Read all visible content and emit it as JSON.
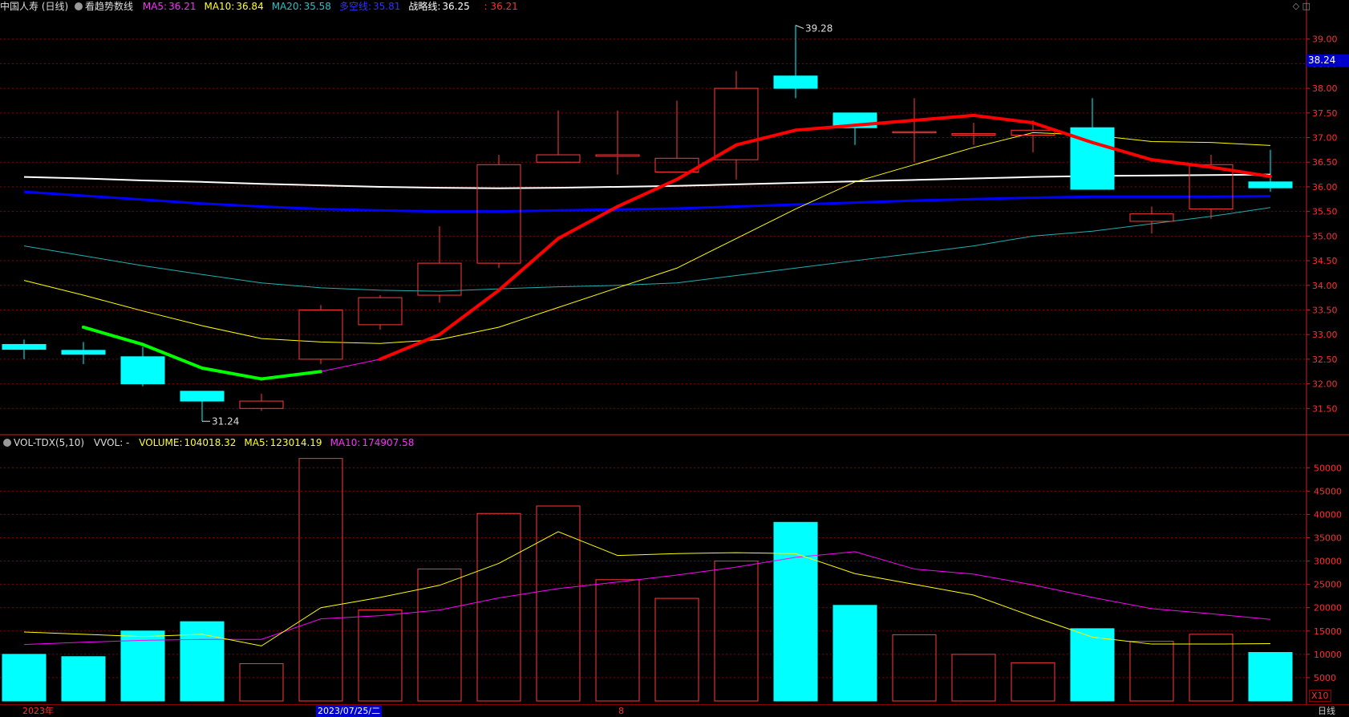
{
  "price_header": {
    "title": "中国人寿 (日线)",
    "indicator": "看趋势数线",
    "items": [
      {
        "label": "MA5:",
        "value": "36.21",
        "color": "#ff30ff"
      },
      {
        "label": "MA10:",
        "value": "36.84",
        "color": "#ffff30"
      },
      {
        "label": "MA20:",
        "value": "35.58",
        "color": "#30c0c0"
      },
      {
        "label": "多空线:",
        "value": "35.81",
        "color": "#3030ff"
      },
      {
        "label": "战略线:",
        "value": "36.25",
        "color": "#ffffff"
      }
    ],
    "extra_value": ": 36.21"
  },
  "vol_header": {
    "indicator": "VOL-TDX(5,10)",
    "vvol": "VVOL: -",
    "items": [
      {
        "label": "VOLUME:",
        "value": "104018.32",
        "color": "#ffff30"
      },
      {
        "label": "MA5:",
        "value": "123014.19",
        "color": "#ffff30"
      },
      {
        "label": "MA10:",
        "value": "174907.58",
        "color": "#ff30ff"
      }
    ]
  },
  "current_price_tag": "38.24",
  "vol_multiplier": "X10",
  "bottom_labels": {
    "year": "2023年",
    "cursor_date": "2023/07/25/二",
    "month": "8",
    "period": "日线"
  },
  "colors": {
    "up": "#ff3a3a",
    "down": "#00ffff",
    "grid": "#8b0000",
    "ma5_up": "#ff0000",
    "ma5_down": "#00ff00",
    "ma10": "#ffff00",
    "ma20": "#20b0b0",
    "duokong": "#0000ff",
    "zhanlue": "#ffffff",
    "vol_ma5": "#ffff00",
    "vol_ma10": "#ff00ff"
  },
  "chart_data": [
    {
      "type": "candlestick",
      "ylim": [
        31.0,
        39.5
      ],
      "yticks": [
        "31.50",
        "32.00",
        "32.50",
        "33.00",
        "33.50",
        "34.00",
        "34.50",
        "35.00",
        "35.50",
        "36.00",
        "36.50",
        "37.00",
        "37.50",
        "38.00",
        "38.50",
        "39.00"
      ],
      "candles": [
        {
          "o": 32.8,
          "h": 32.9,
          "l": 32.5,
          "c": 32.7
        },
        {
          "o": 32.68,
          "h": 32.85,
          "l": 32.4,
          "c": 32.6
        },
        {
          "o": 32.55,
          "h": 32.75,
          "l": 31.95,
          "c": 32.0
        },
        {
          "o": 31.85,
          "h": 31.85,
          "l": 31.24,
          "c": 31.65
        },
        {
          "o": 31.5,
          "h": 31.8,
          "l": 31.45,
          "c": 31.65
        },
        {
          "o": 32.5,
          "h": 33.6,
          "l": 32.4,
          "c": 33.5
        },
        {
          "o": 33.2,
          "h": 33.8,
          "l": 33.1,
          "c": 33.75
        },
        {
          "o": 33.8,
          "h": 35.2,
          "l": 33.65,
          "c": 34.45
        },
        {
          "o": 34.45,
          "h": 36.65,
          "l": 34.35,
          "c": 36.45
        },
        {
          "o": 36.5,
          "h": 37.55,
          "l": 36.5,
          "c": 36.65
        },
        {
          "o": 36.62,
          "h": 37.55,
          "l": 36.25,
          "c": 36.65
        },
        {
          "o": 36.3,
          "h": 37.75,
          "l": 36.3,
          "c": 36.58
        },
        {
          "o": 36.55,
          "h": 38.35,
          "l": 36.15,
          "c": 38.0
        },
        {
          "o": 38.25,
          "h": 39.28,
          "l": 37.8,
          "c": 38.0
        },
        {
          "o": 37.5,
          "h": 37.5,
          "l": 36.85,
          "c": 37.2
        },
        {
          "o": 37.1,
          "h": 37.8,
          "l": 36.5,
          "c": 37.12
        },
        {
          "o": 37.05,
          "h": 37.3,
          "l": 36.85,
          "c": 37.08
        },
        {
          "o": 37.05,
          "h": 37.35,
          "l": 36.7,
          "c": 37.15
        },
        {
          "o": 37.2,
          "h": 37.8,
          "l": 35.95,
          "c": 35.95
        },
        {
          "o": 35.3,
          "h": 35.6,
          "l": 35.05,
          "c": 35.45
        },
        {
          "o": 35.55,
          "h": 36.65,
          "l": 35.35,
          "c": 36.45
        },
        {
          "o": 36.1,
          "h": 36.75,
          "l": 35.9,
          "c": 35.98
        }
      ],
      "ma5": [
        null,
        33.15,
        32.8,
        32.32,
        32.1,
        32.25,
        32.5,
        33.0,
        33.9,
        34.95,
        35.6,
        36.15,
        36.85,
        37.15,
        37.25,
        37.35,
        37.45,
        37.3,
        36.9,
        36.55,
        36.4,
        36.21
      ],
      "ma10": [
        34.1,
        33.8,
        33.48,
        33.18,
        32.92,
        32.85,
        32.82,
        32.9,
        33.15,
        33.55,
        33.95,
        34.35,
        34.95,
        35.55,
        36.1,
        36.45,
        36.8,
        37.1,
        37.05,
        36.92,
        36.9,
        36.84
      ],
      "ma20": [
        34.8,
        34.6,
        34.4,
        34.22,
        34.05,
        33.95,
        33.9,
        33.88,
        33.93,
        33.97,
        34.0,
        34.05,
        34.2,
        34.35,
        34.5,
        34.65,
        34.8,
        35.0,
        35.1,
        35.25,
        35.4,
        35.58
      ],
      "duokong": [
        35.9,
        35.82,
        35.74,
        35.66,
        35.6,
        35.55,
        35.52,
        35.5,
        35.5,
        35.52,
        35.54,
        35.56,
        35.6,
        35.64,
        35.68,
        35.72,
        35.75,
        35.78,
        35.8,
        35.8,
        35.8,
        35.81
      ],
      "zhanlue": [
        36.2,
        36.17,
        36.13,
        36.1,
        36.06,
        36.03,
        36.0,
        35.98,
        35.97,
        35.98,
        36.0,
        36.02,
        36.05,
        36.08,
        36.11,
        36.14,
        36.17,
        36.2,
        36.22,
        36.23,
        36.24,
        36.25
      ],
      "annotations": [
        {
          "index": 13,
          "value": 39.28,
          "label": "39.28"
        },
        {
          "index": 3,
          "value": 31.24,
          "label": "31.24"
        }
      ]
    },
    {
      "type": "bar",
      "ylim": [
        0,
        54000
      ],
      "yticks": [
        "5000",
        "10000",
        "15000",
        "20000",
        "25000",
        "30000",
        "35000",
        "40000",
        "45000",
        "50000"
      ],
      "volumes": [
        10000,
        9500,
        15000,
        17000,
        8000,
        52000,
        19500,
        28300,
        40200,
        41800,
        26000,
        22000,
        30000,
        38300,
        20500,
        14200,
        10000,
        8200,
        15500,
        12800,
        14300,
        10400
      ],
      "ma5": [
        14800,
        14300,
        13800,
        14300,
        11800,
        20000,
        22200,
        24800,
        29500,
        36300,
        31200,
        31600,
        31800,
        31600,
        27300,
        25000,
        22700,
        18100,
        13700,
        12200,
        12200,
        12300
      ],
      "ma10": [
        12100,
        12600,
        13000,
        13200,
        13200,
        17600,
        18300,
        19500,
        22100,
        24100,
        25500,
        27000,
        28700,
        30800,
        32000,
        28300,
        27200,
        24900,
        22200,
        19800,
        18700,
        17500
      ]
    }
  ]
}
